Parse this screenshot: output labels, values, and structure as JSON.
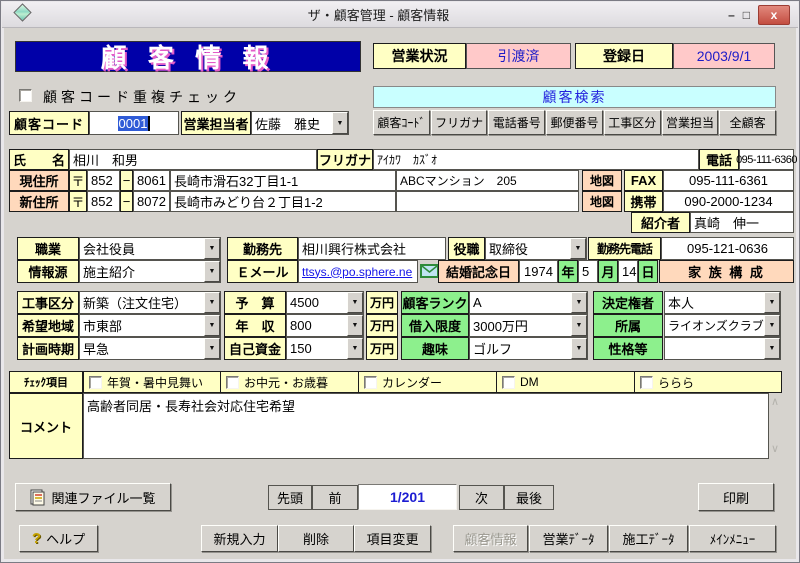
{
  "icons": {
    "dropdown": "▼",
    "scroll_up": "∧",
    "scroll_down": "∨",
    "minimize": "–",
    "maximize": "□",
    "close": "x",
    "help_mark": "?",
    "postal_mark": "〒",
    "zip_dash": "−"
  },
  "colors": {
    "banner_blue": "#0000a8",
    "label_yellow": "#ffffc4",
    "label_peach": "#ffd9bc",
    "label_green": "#8df08d",
    "panel_cyan": "#c9ffff",
    "value_pink": "#ffc9c9",
    "link_blue": "#1414e8",
    "close_red": "#c34d41",
    "window_gray": "#d6d3ce"
  },
  "window": {
    "title": "ザ・顧客管理 - 顧客情報"
  },
  "header": {
    "title": "顧 客 情 報",
    "status_label": "営業状況",
    "status_value": "引渡済",
    "regdate_label": "登録日",
    "regdate_value": "2003/9/1"
  },
  "code_row": {
    "dup_check_label": "顧客コード重複チェック",
    "code_label": "顧客コード",
    "code_value": "0001",
    "rep_label": "営業担当者",
    "rep_value": "佐藤　雅史"
  },
  "search": {
    "title": "顧客検索",
    "buttons": [
      "顧客ｺｰﾄﾞ",
      "フリガナ",
      "電話番号",
      "郵便番号",
      "工事区分",
      "営業担当",
      "全顧客"
    ]
  },
  "identity": {
    "name_label": "氏　　名",
    "name_value": "相川　和男",
    "kana_label": "フリガナ",
    "kana_value": "ｱｲｶﾜ　ｶｽﾞｵ",
    "tel_label": "電話",
    "tel_value": "095-111-6360",
    "cur_addr_label": "現住所",
    "cur_zip1": "852",
    "cur_zip2": "8061",
    "cur_addr": "長崎市滑石32丁目1-1",
    "cur_bldg": "ABCマンション　205",
    "new_addr_label": "新住所",
    "new_zip1": "852",
    "new_zip2": "8072",
    "new_addr": "長崎市みどり台２丁目1-2",
    "new_bldg": "",
    "map_label": "地図",
    "fax_label": "FAX",
    "fax_value": "095-111-6361",
    "mobile_label": "携帯",
    "mobile_value": "090-2000-1234",
    "introducer_label": "紹介者",
    "introducer_value": "真崎　伸一"
  },
  "work": {
    "job_label": "職業",
    "job_value": "会社役員",
    "source_label": "情報源",
    "source_value": "施主紹介",
    "office_label": "勤務先",
    "office_value": "相川興行株式会社",
    "email_label": "Ｅメール",
    "email_value": "ttsys.@po.sphere.ne",
    "title_label": "役職",
    "title_value": "取締役",
    "office_tel_label": "勤務先電話",
    "office_tel_value": "095-121-0636",
    "anniv_label": "結婚記念日",
    "anniv_year": "1974",
    "year_unit": "年",
    "anniv_month": "5",
    "month_unit": "月",
    "anniv_day": "14",
    "day_unit": "日",
    "family_button": "家 族 構 成"
  },
  "project": {
    "const_label": "工事区分",
    "const_value": "新築（注文住宅）",
    "area_label": "希望地域",
    "area_value": "市東部",
    "timing_label": "計画時期",
    "timing_value": "早急",
    "budget_label": "予　算",
    "budget_value": "4500",
    "income_label": "年　収",
    "income_value": "800",
    "funds_label": "自己資金",
    "funds_value": "150",
    "man_yen": "万円",
    "rank_label": "顧客ランク",
    "rank_value": "A",
    "loan_label": "借入限度",
    "loan_value": "3000万円",
    "hobby_label": "趣味",
    "hobby_value": "ゴルフ",
    "decider_label": "決定権者",
    "decider_value": "本人",
    "belong_label": "所属",
    "belong_value": "ライオンズクラブ",
    "personality_label": "性格等",
    "personality_value": ""
  },
  "checks": {
    "label": "ﾁｪｯｸ項目",
    "items": [
      "年賀・暑中見舞い",
      "お中元・お歳暮",
      "カレンダー",
      "DM",
      "ららら"
    ]
  },
  "comment": {
    "label": "コメント",
    "value": "高齢者同居・長寿社会対応住宅希望"
  },
  "nav": {
    "files_button": "関連ファイル一覧",
    "first": "先頭",
    "prev": "前",
    "counter": "1/201",
    "next": "次",
    "last": "最後",
    "print": "印刷"
  },
  "footer": {
    "help": "ヘルプ",
    "new": "新規入力",
    "delete": "削除",
    "modify": "項目変更",
    "customer_info": "顧客情報",
    "sales_data": "営業ﾃﾞｰﾀ",
    "construction_data": "施工ﾃﾞｰﾀ",
    "main_menu": "ﾒｲﾝﾒﾆｭｰ"
  }
}
